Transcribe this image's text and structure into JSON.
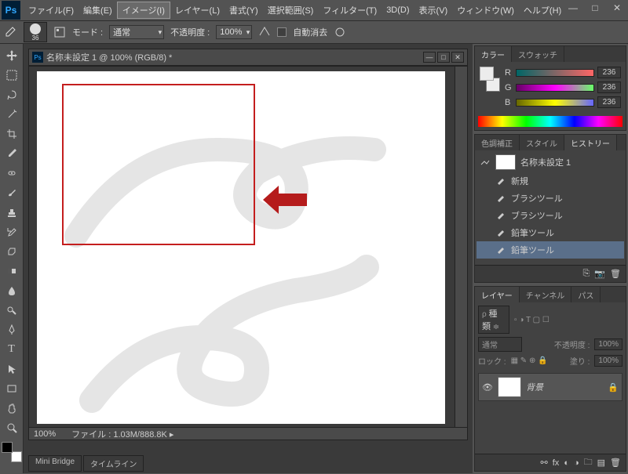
{
  "app": {
    "logo": "Ps"
  },
  "menu": {
    "items": [
      "ファイル(F)",
      "編集(E)",
      "イメージ(I)",
      "レイヤー(L)",
      "書式(Y)",
      "選択範囲(S)",
      "フィルター(T)",
      "3D(D)",
      "表示(V)",
      "ウィンドウ(W)",
      "ヘルプ(H)"
    ],
    "active_index": 2
  },
  "optionbar": {
    "brush_size": "36",
    "mode_label": "モード :",
    "mode_value": "通常",
    "opacity_label": "不透明度 :",
    "opacity_value": "100%",
    "autoerase_label": "自動消去"
  },
  "document": {
    "title": "名称未設定 1 @ 100% (RGB/8) *",
    "zoom": "100%",
    "filesize_label": "ファイル :",
    "filesize": "1.03M/888.8K"
  },
  "bottom_tabs": [
    "Mini Bridge",
    "タイムライン"
  ],
  "color_panel": {
    "tabs": [
      "カラー",
      "スウォッチ"
    ],
    "channels": [
      {
        "ch": "R",
        "val": "236",
        "grad": "linear-gradient(90deg,#066,#f66)"
      },
      {
        "ch": "G",
        "val": "236",
        "grad": "linear-gradient(90deg,#606,#f0f,#6f6)"
      },
      {
        "ch": "B",
        "val": "236",
        "grad": "linear-gradient(90deg,#660,#ff0,#66f)"
      }
    ]
  },
  "history_panel": {
    "tabs": [
      "色調補正",
      "スタイル",
      "ヒストリー"
    ],
    "snapshot": "名称未設定 1",
    "items": [
      "新規",
      "ブラシツール",
      "ブラシツール",
      "鉛筆ツール",
      "鉛筆ツール"
    ],
    "selected": 4
  },
  "layers_panel": {
    "tabs": [
      "レイヤー",
      "チャンネル",
      "パス"
    ],
    "kind_label": "種類",
    "blend_mode": "通常",
    "opacity_label": "不透明度 :",
    "opacity_value": "100%",
    "lock_label": "ロック :",
    "fill_label": "塗り :",
    "fill_value": "100%",
    "layer_name": "背景"
  }
}
